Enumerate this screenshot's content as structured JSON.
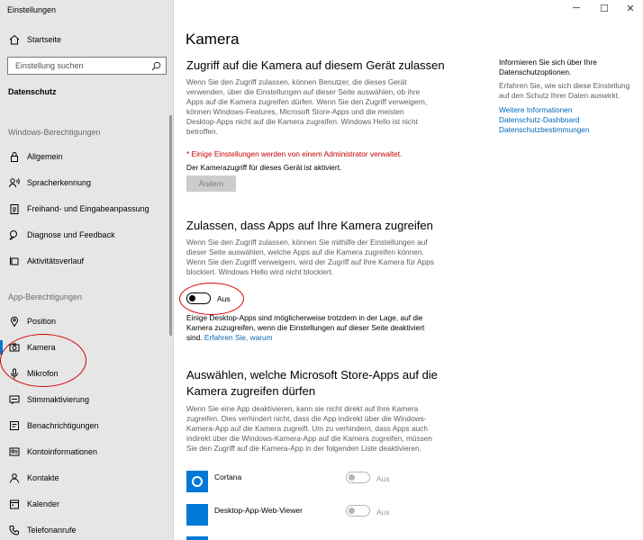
{
  "window": {
    "title": "Einstellungen",
    "minimize": "─",
    "maximize": "☐",
    "close": "✕"
  },
  "sidebar": {
    "home_label": "Startseite",
    "search_placeholder": "Einstellung suchen",
    "category": "Datenschutz",
    "groups": [
      {
        "title": "Windows-Berechtigungen",
        "items": [
          "Allgemein",
          "Spracherkennung",
          "Freihand- und Eingabeanpassung",
          "Diagnose und Feedback",
          "Aktivitätsverlauf"
        ]
      },
      {
        "title": "App-Berechtigungen",
        "items": [
          "Position",
          "Kamera",
          "Mikrofon",
          "Stimmaktivierung",
          "Benachrichtigungen",
          "Kontoinformationen",
          "Kontakte",
          "Kalender",
          "Telefonanrufe"
        ]
      }
    ],
    "active_item": "Kamera"
  },
  "main": {
    "title": "Kamera",
    "section1": {
      "heading": "Zugriff auf die Kamera auf diesem Gerät zulassen",
      "desc": "Wenn Sie den Zugriff zulassen, können Benutzer, die dieses Gerät verwenden, über die Einstellungen auf dieser Seite auswählen, ob ihre Apps auf die Kamera zugreifen dürfen. Wenn Sie den Zugriff verweigern, können Windows-Features, Microsoft Store-Apps und die meisten Desktop-Apps nicht auf die Kamera zugreifen. Windows Hello ist nicht betroffen.",
      "warning": "* Einige Einstellungen werden von einem Administrator verwaltet.",
      "status": "Der Kamerazugriff für dieses Gerät ist aktiviert.",
      "button": "Ändern"
    },
    "section2": {
      "heading": "Zulassen, dass Apps auf Ihre Kamera zugreifen",
      "desc": "Wenn Sie den Zugriff zulassen, können Sie mithilfe der Einstellungen auf dieser Seite auswählen, welche Apps auf die Kamera zugreifen können. Wenn Sie den Zugriff verweigern, wird der Zugriff auf Ihre Kamera für Apps blockiert. Windows Hello wird nicht blockiert.",
      "toggle_label": "Aus",
      "note": "Einige Desktop-Apps sind möglicherweise trotzdem in der Lage, auf die Kamera zuzugreifen, wenn die Einstellungen auf dieser Seite deaktiviert sind.",
      "note_link": "Erfahren Sie, warum"
    },
    "section3": {
      "heading": "Auswählen, welche Microsoft Store-Apps auf die Kamera zugreifen dürfen",
      "desc": "Wenn Sie eine App deaktivieren, kann sie nicht direkt auf Ihre Kamera zugreifen. Dies verhindert nicht, dass die App indirekt über die Windows-Kamera-App auf die Kamera zugreift. Um zu verhindern, dass Apps auch indirekt über die Windows-Kamera-App auf die Kamera zugreifen, müssen Sie den Zugriff auf die Kamera-App in der folgenden Liste deaktivieren.",
      "apps": [
        {
          "name": "Cortana",
          "state": "Aus"
        },
        {
          "name": "Desktop-App-Web-Viewer",
          "state": "Aus"
        }
      ]
    }
  },
  "right_panel": {
    "p1": "Informieren Sie sich über Ihre Datenschutzoptionen.",
    "p2": "Erfahren Sie, wie sich diese Einstellung auf den Schutz Ihrer Daten auswirkt.",
    "links": [
      "Weitere Informationen",
      "Datenschutz-Dashboard",
      "Datenschutzbestimmungen"
    ]
  },
  "colors": {
    "accent": "#0078d7",
    "warning": "#c50000",
    "link": "#0067b8",
    "annotation": "#d50000"
  }
}
